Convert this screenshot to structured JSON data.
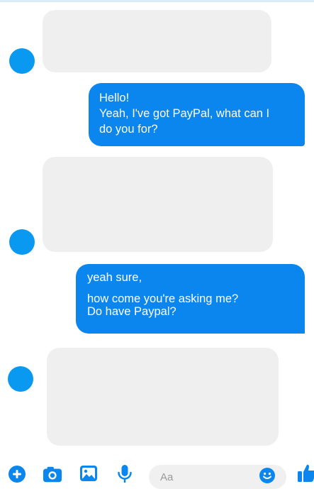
{
  "colors": {
    "accent": "#0a86ee",
    "avatar": "#0a99f0",
    "incoming_bubble": "#efefef",
    "outgoing_text": "#ffffff",
    "input_bg": "#f0f0f0"
  },
  "messages": [
    {
      "direction": "incoming",
      "text": ""
    },
    {
      "direction": "outgoing",
      "lines": [
        "Hello!",
        "Yeah, I've got PayPal, what can I",
        "do you for?"
      ]
    },
    {
      "direction": "incoming",
      "text": ""
    },
    {
      "direction": "outgoing",
      "lines": [
        "yeah sure,",
        "how come  you're asking me?",
        "Do have Paypal?"
      ]
    },
    {
      "direction": "incoming",
      "text": ""
    }
  ],
  "composer": {
    "placeholder": "Aa",
    "icons": [
      "plus-icon",
      "camera-icon",
      "image-icon",
      "microphone-icon",
      "emoji-icon",
      "thumbs-up-icon"
    ]
  }
}
